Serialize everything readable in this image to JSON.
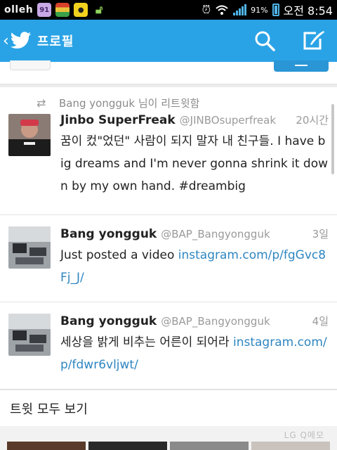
{
  "status": {
    "carrier": "olleh",
    "badge": "91",
    "battery_text": "91%",
    "time": "오전 8:54"
  },
  "header": {
    "title": "프로필"
  },
  "tweets": [
    {
      "retweet_by": "Bang yongguk 님이 리트윗함",
      "name": "Jinbo SuperFreak",
      "handle": "@JINBOsuperfreak",
      "time": "20시간",
      "text": "꿈이 컸\"었던\" 사람이 되지 말자 내 친구들. I have big dreams and I'm never gonna shrink it down by my own hand. #dreambig",
      "link": ""
    },
    {
      "name": "Bang yongguk",
      "handle": "@BAP_Bangyongguk",
      "time": "3일",
      "text": "Just posted a video ",
      "link": "instagram.com/p/fgGvc8Fj_J/"
    },
    {
      "name": "Bang yongguk",
      "handle": "@BAP_Bangyongguk",
      "time": "4일",
      "text": "세상을 밝게 비추는 어른이 되어라 ",
      "link": "instagram.com/p/fdwr6vljwt/"
    }
  ],
  "view_all": "트윗 모두 보기",
  "watermark": "LG Q메모",
  "icons": {
    "back": "chevron-left-icon",
    "logo": "twitter-bird-icon",
    "search": "search-icon",
    "compose": "compose-icon",
    "retweet": "retweet-icon"
  },
  "colors": {
    "accent": "#2aa3e6",
    "link": "#2e86c1",
    "muted": "#9a9a9a"
  }
}
